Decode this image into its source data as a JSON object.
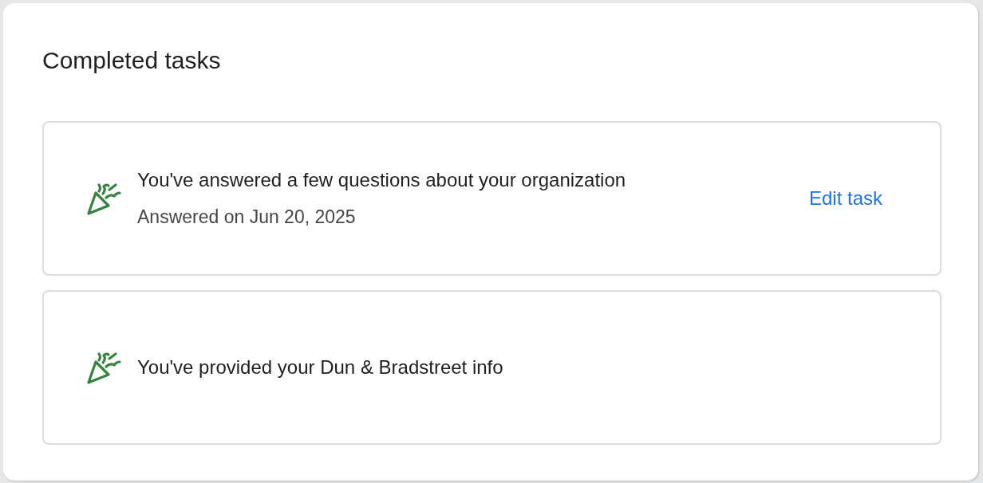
{
  "title": "Completed tasks",
  "tasks": [
    {
      "title": "You've answered a few questions about your organization",
      "subtitle": "Answered on Jun 20, 2025",
      "action": "Edit task"
    },
    {
      "title": "You've provided your Dun & Bradstreet info"
    }
  ]
}
